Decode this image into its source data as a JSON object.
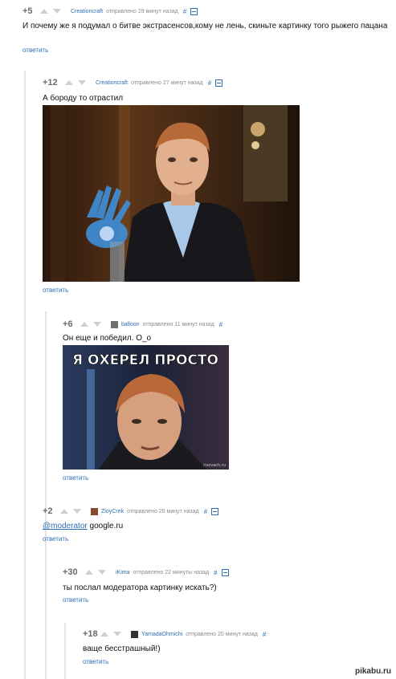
{
  "comments": [
    {
      "rating": "+5",
      "author": "Creationcraft",
      "time": "отправлено 29 минут назад",
      "hash": "#",
      "text": "И почему же я подумал о битве экстрасенсов,кому не лень, скиньте картинку того рыжего пацана",
      "reply": "ответить"
    },
    {
      "rating": "+12",
      "author": "Creationcraft",
      "time": "отправлено 27 минут назад",
      "hash": "#",
      "text": "А бороду то отрастил",
      "reply": "ответить"
    },
    {
      "rating": "+6",
      "author": "balloon",
      "time": "отправлено 11 минут назад",
      "hash": "#",
      "text": "Он еще и победил. О_о",
      "reply": "ответить",
      "image_caption": "Я ОХЕРЕЛ ПРОСТО",
      "image_site": "risovach.ru"
    },
    {
      "rating": "+2",
      "author": "ZloyCrek",
      "time": "отправлено 26 минут назад",
      "hash": "#",
      "mention": "@moderator",
      "text": " google.ru",
      "reply": "ответить"
    },
    {
      "rating": "+30",
      "author": "iKima",
      "time": "отправлено 22 минуты назад",
      "hash": "#",
      "text": "ты послал модератора картинку искать?)",
      "reply": "ответить"
    },
    {
      "rating": "+18",
      "author": "YamadaOhmichi",
      "time": "отправлено 20 минут назад",
      "hash": "#",
      "text": "ваще бесстрашный!)",
      "reply": "ответить"
    }
  ],
  "watermark": "pikabu.ru"
}
